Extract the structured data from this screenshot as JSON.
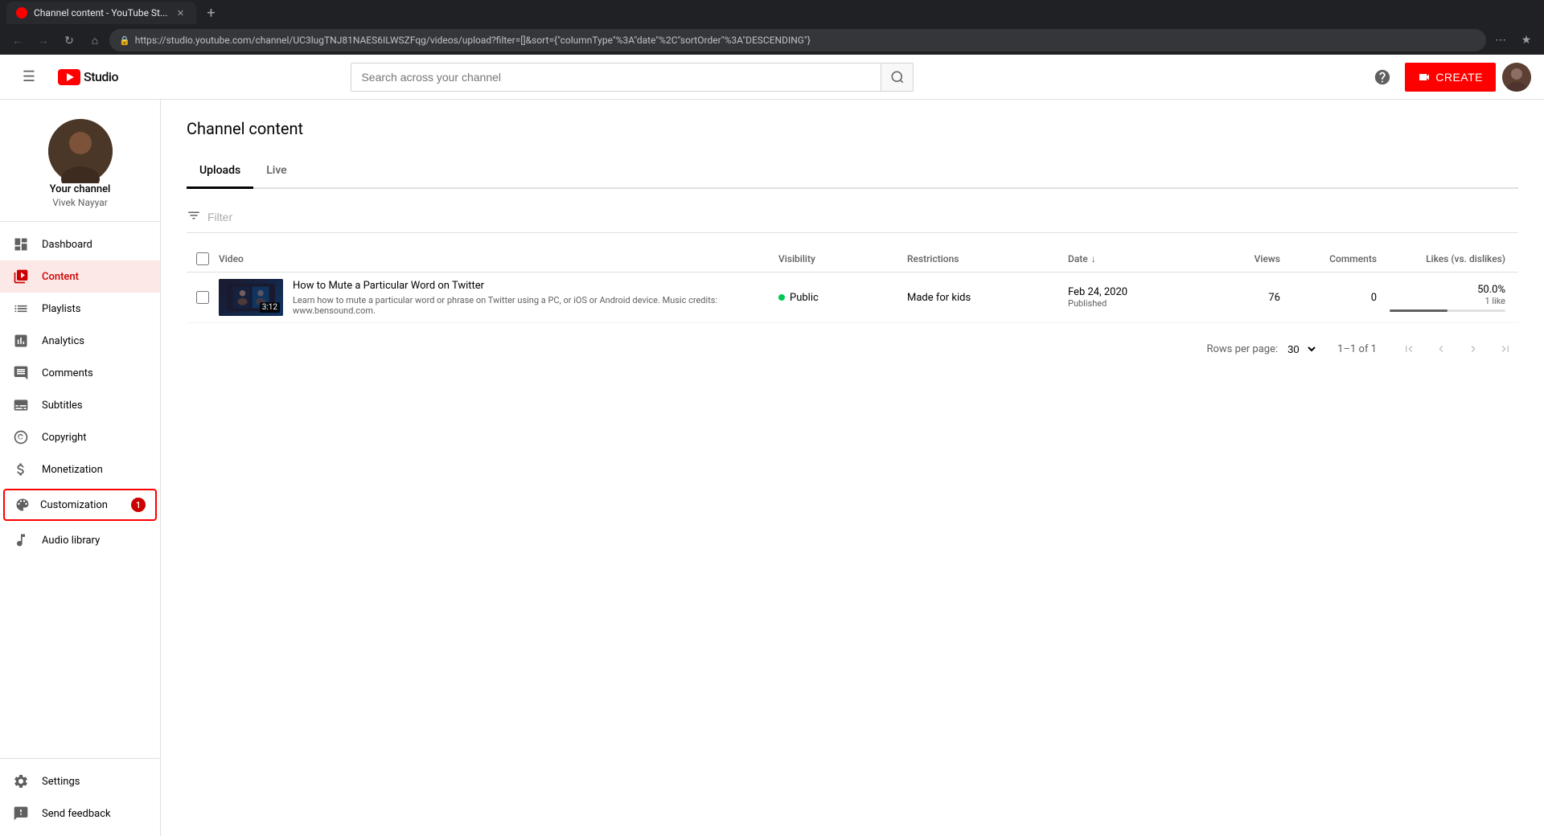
{
  "browser": {
    "tab_title": "Channel content - YouTube St...",
    "tab_favicon": "yt",
    "url": "https://studio.youtube.com/channel/UC3lugTNJ81NAES6ILWSZFqg/videos/upload?filter=[]&sort={\"columnType\"%3A\"date\"%2C\"sortOrder\"%3A\"DESCENDING\"}",
    "new_tab_label": "+"
  },
  "topbar": {
    "hamburger_label": "☰",
    "logo_yt": "▶",
    "logo_studio": "Studio",
    "search_placeholder": "Search across your channel",
    "help_icon": "?",
    "create_label": "CREATE",
    "create_icon": "▶"
  },
  "sidebar": {
    "channel_name": "Your channel",
    "channel_handle": "Vivek Nayyar",
    "nav_items": [
      {
        "id": "dashboard",
        "label": "Dashboard",
        "icon": "⊞"
      },
      {
        "id": "content",
        "label": "Content",
        "icon": "▶",
        "active": true
      },
      {
        "id": "playlists",
        "label": "Playlists",
        "icon": "☰"
      },
      {
        "id": "analytics",
        "label": "Analytics",
        "icon": "📊"
      },
      {
        "id": "comments",
        "label": "Comments",
        "icon": "💬"
      },
      {
        "id": "subtitles",
        "label": "Subtitles",
        "icon": "CC"
      },
      {
        "id": "copyright",
        "label": "Copyright",
        "icon": "©"
      },
      {
        "id": "monetization",
        "label": "Monetization",
        "icon": "$"
      },
      {
        "id": "customization",
        "label": "Customization",
        "icon": "✦",
        "badge": "1"
      },
      {
        "id": "audio_library",
        "label": "Audio library",
        "icon": "♪"
      }
    ],
    "bottom_items": [
      {
        "id": "settings",
        "label": "Settings",
        "icon": "⚙"
      },
      {
        "id": "send_feedback",
        "label": "Send feedback",
        "icon": "⚑"
      }
    ]
  },
  "content": {
    "page_title": "Channel content",
    "tabs": [
      {
        "id": "uploads",
        "label": "Uploads",
        "active": true
      },
      {
        "id": "live",
        "label": "Live"
      }
    ],
    "filter_placeholder": "Filter",
    "table": {
      "columns": [
        {
          "id": "check",
          "label": ""
        },
        {
          "id": "video",
          "label": "Video"
        },
        {
          "id": "visibility",
          "label": "Visibility"
        },
        {
          "id": "restrictions",
          "label": "Restrictions"
        },
        {
          "id": "date",
          "label": "Date",
          "sortable": true,
          "sort_dir": "desc"
        },
        {
          "id": "views",
          "label": "Views"
        },
        {
          "id": "comments",
          "label": "Comments"
        },
        {
          "id": "likes",
          "label": "Likes (vs. dislikes)"
        }
      ],
      "rows": [
        {
          "id": "row1",
          "video_title": "How to Mute a Particular Word on Twitter",
          "video_desc": "Learn how to mute a particular word or phrase on Twitter using a PC, or iOS or Android device. Music credits: www.bensound.com.",
          "duration": "3:12",
          "visibility": "Public",
          "visibility_color": "#00c853",
          "restrictions": "Made for kids",
          "date_main": "Feb 24, 2020",
          "date_sub": "Published",
          "views": "76",
          "comments": "0",
          "likes_percent": "50.0%",
          "likes_count": "1 like",
          "likes_fill": 50
        }
      ]
    },
    "pagination": {
      "rows_per_page_label": "Rows per page:",
      "rows_per_page_value": "30",
      "page_range": "1–1 of 1"
    }
  }
}
